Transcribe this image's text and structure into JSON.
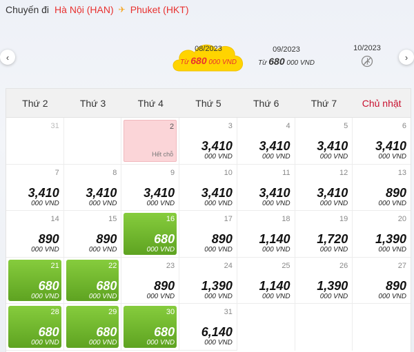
{
  "route": {
    "label": "Chuyến đi",
    "origin": "Hà Nội (HAN)",
    "destination": "Phuket (HKT)"
  },
  "months": [
    {
      "name": "08/2023",
      "from": "Từ",
      "price": "680",
      "unit": "000 VND",
      "active": true
    },
    {
      "name": "09/2023",
      "from": "Từ",
      "price": "680",
      "unit": "000 VND",
      "active": false
    },
    {
      "name": "10/2023",
      "unavailable": true
    }
  ],
  "weekdays": [
    "Thứ 2",
    "Thứ 3",
    "Thứ 4",
    "Thứ 5",
    "Thứ 6",
    "Thứ 7",
    "Chủ nhật"
  ],
  "currency": "000 VND",
  "sold_out": "Hết chỗ",
  "days": [
    {
      "day": "31",
      "muted": true
    },
    {
      "day": ""
    },
    {
      "day": "2",
      "soldout": true
    },
    {
      "day": "3",
      "price": "3,410"
    },
    {
      "day": "4",
      "price": "3,410"
    },
    {
      "day": "5",
      "price": "3,410"
    },
    {
      "day": "6",
      "price": "3,410"
    },
    {
      "day": "7",
      "price": "3,410"
    },
    {
      "day": "8",
      "price": "3,410"
    },
    {
      "day": "9",
      "price": "3,410"
    },
    {
      "day": "10",
      "price": "3,410"
    },
    {
      "day": "11",
      "price": "3,410"
    },
    {
      "day": "12",
      "price": "3,410"
    },
    {
      "day": "13",
      "price": "890"
    },
    {
      "day": "14",
      "price": "890"
    },
    {
      "day": "15",
      "price": "890"
    },
    {
      "day": "16",
      "price": "680",
      "best": true
    },
    {
      "day": "17",
      "price": "890"
    },
    {
      "day": "18",
      "price": "1,140"
    },
    {
      "day": "19",
      "price": "1,720"
    },
    {
      "day": "20",
      "price": "1,390"
    },
    {
      "day": "21",
      "price": "680",
      "best": true
    },
    {
      "day": "22",
      "price": "680",
      "best": true
    },
    {
      "day": "23",
      "price": "890"
    },
    {
      "day": "24",
      "price": "1,390"
    },
    {
      "day": "25",
      "price": "1,140"
    },
    {
      "day": "26",
      "price": "1,390"
    },
    {
      "day": "27",
      "price": "890"
    },
    {
      "day": "28",
      "price": "680",
      "best": true
    },
    {
      "day": "29",
      "price": "680",
      "best": true
    },
    {
      "day": "30",
      "price": "680",
      "best": true
    },
    {
      "day": "31",
      "price": "6,140"
    },
    {
      "empty": true
    },
    {
      "empty": true
    },
    {
      "empty": true
    }
  ],
  "colors": {
    "accent": "#e8312f",
    "best_green": "#6cb52a",
    "soldout_pink": "#fbd5d8",
    "cloud_yellow": "#ffd400"
  }
}
